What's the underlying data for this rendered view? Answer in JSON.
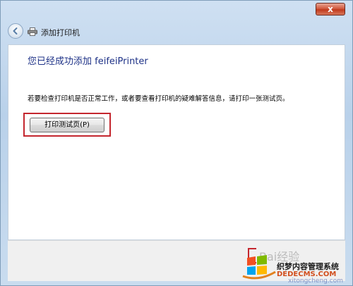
{
  "window": {
    "title": "添加打印机",
    "close_label": "x"
  },
  "content": {
    "headline": "您已经成功添加 feifeiPrinter",
    "instruction": "若要检查打印机是否正常工作，或者要查看打印机的疑难解答信息，请打印一张测试页。",
    "print_test_page_label": "打印测试页(P)"
  },
  "bottom": {
    "faded_text": "Bai经验"
  },
  "watermark": {
    "brand": "织梦内容管理系统",
    "url": "DEDECMS.COM",
    "domain": "xitongcheng.com"
  },
  "colors": {
    "headline": "#1e3287",
    "highlight_border": "#c4262e",
    "close_button": "#c03a1c"
  }
}
